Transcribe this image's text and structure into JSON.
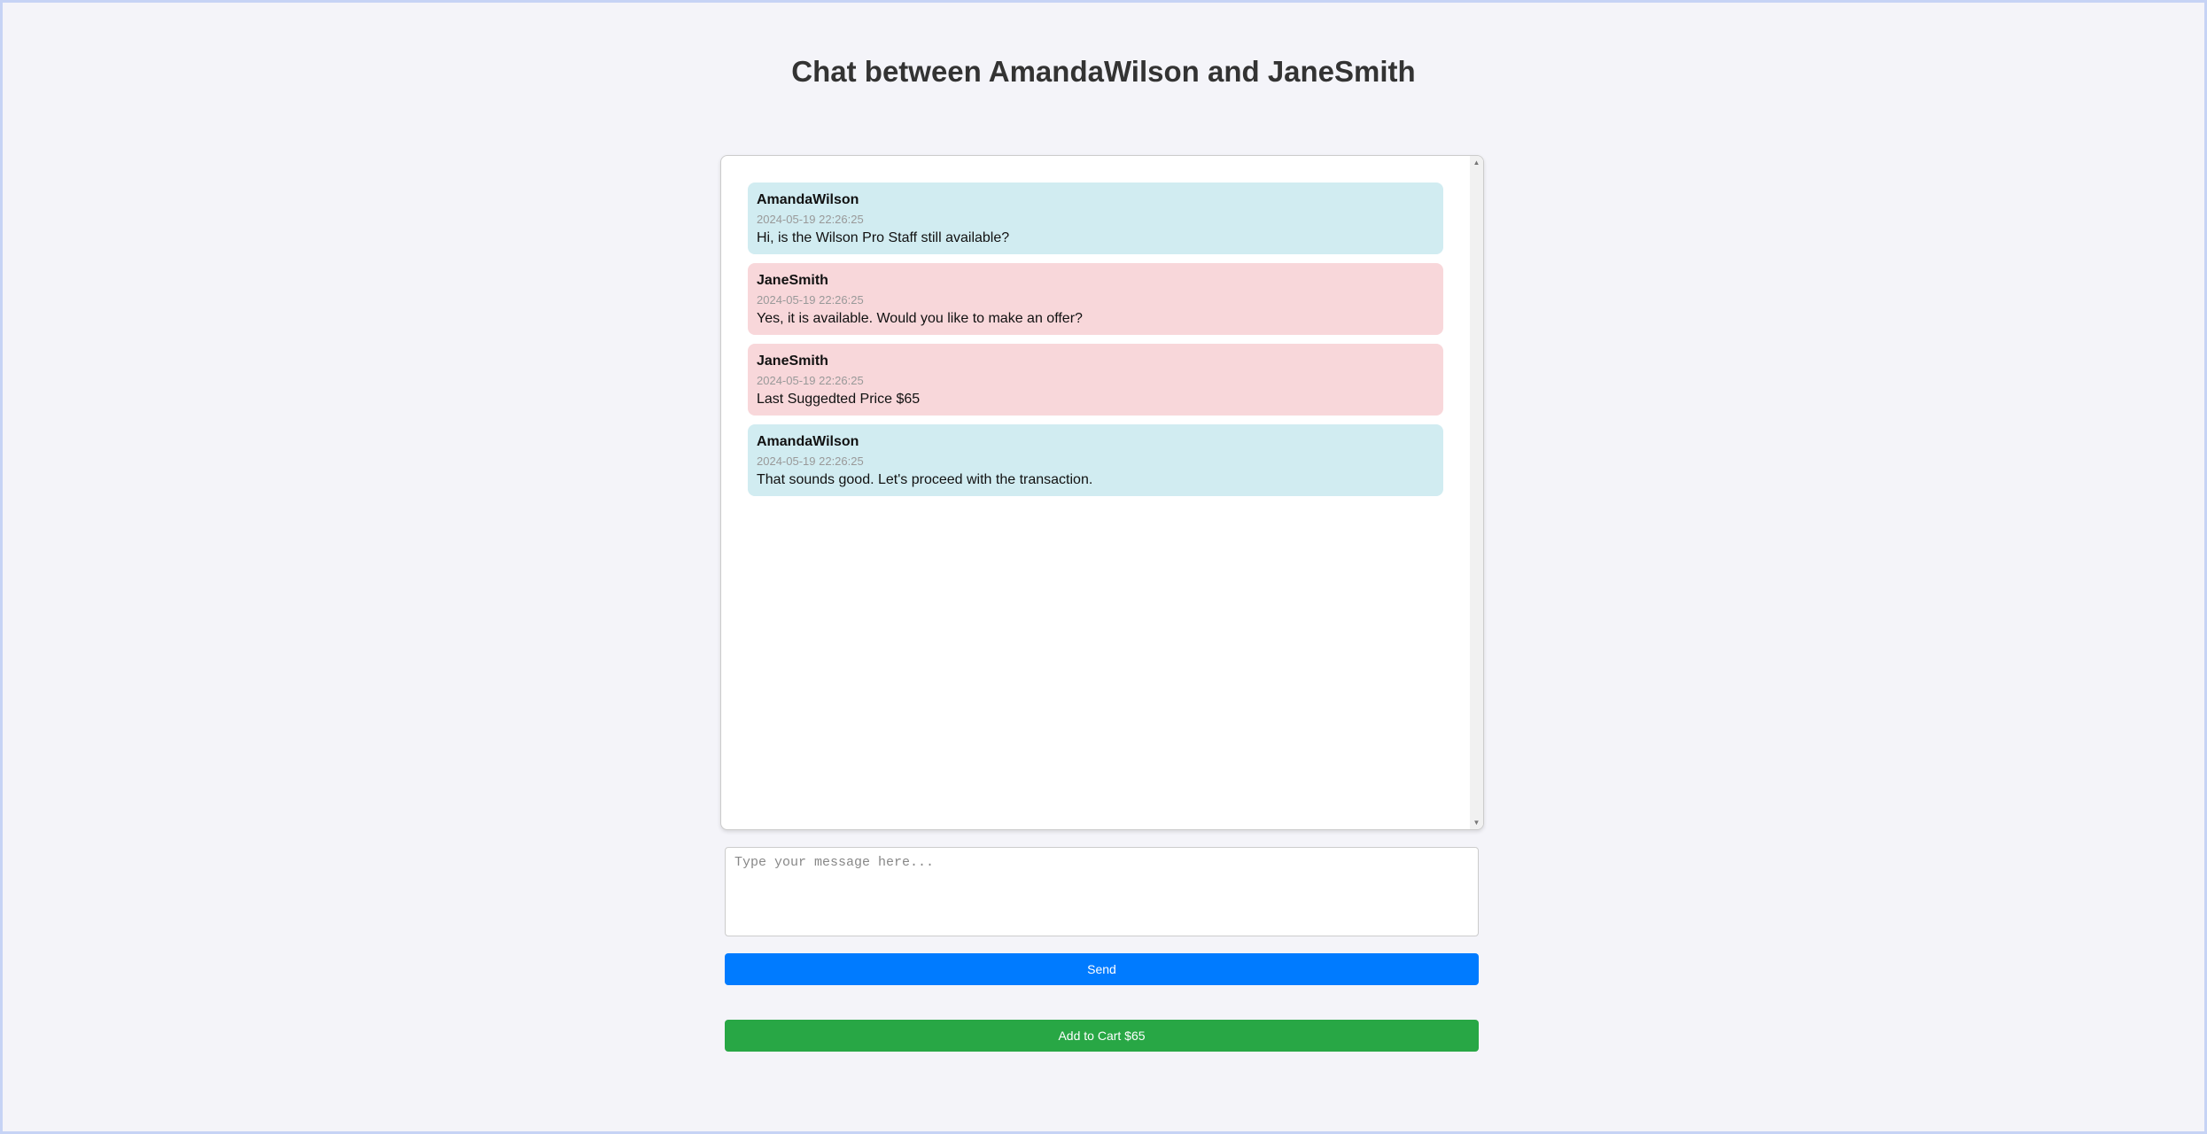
{
  "page": {
    "title": "Chat between AmandaWilson and JaneSmith"
  },
  "messages": [
    {
      "user": "AmandaWilson",
      "time": "2024-05-19 22:26:25",
      "text": "Hi, is the Wilson Pro Staff still available?",
      "side": "a"
    },
    {
      "user": "JaneSmith",
      "time": "2024-05-19 22:26:25",
      "text": "Yes, it is available. Would you like to make an offer?",
      "side": "b"
    },
    {
      "user": "JaneSmith",
      "time": "2024-05-19 22:26:25",
      "text": "Last Suggedted Price $65",
      "side": "b"
    },
    {
      "user": "AmandaWilson",
      "time": "2024-05-19 22:26:25",
      "text": "That sounds good. Let's proceed with the transaction.",
      "side": "a"
    }
  ],
  "composer": {
    "placeholder": "Type your message here...",
    "value": ""
  },
  "actions": {
    "send_label": "Send",
    "cart_label": "Add to Cart $65"
  },
  "colors": {
    "background": "#f4f4f9",
    "bubble_a": "#d1ecf1",
    "bubble_b": "#f8d7da",
    "send_button": "#007bff",
    "cart_button": "#28a745"
  },
  "icons": {
    "scroll_up": "scroll-up-arrow-icon",
    "scroll_down": "scroll-down-arrow-icon"
  }
}
